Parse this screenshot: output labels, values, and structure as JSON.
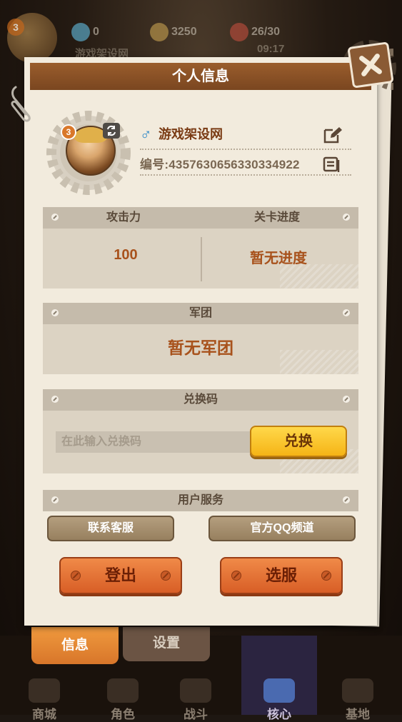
{
  "top_bar": {
    "level": "3",
    "player_name": "游戏架设网",
    "gems": "0",
    "gold": "3250",
    "stamina": "26/30",
    "timer": "09:17"
  },
  "modal": {
    "title": "个人信息",
    "level": "3",
    "player_name": "游戏架设网",
    "player_id": "编号:4357630656330334922",
    "stats": {
      "attack_label": "攻击力",
      "progress_label": "关卡进度",
      "attack_value": "100",
      "progress_value": "暂无进度"
    },
    "legion": {
      "label": "军团",
      "value": "暂无军团"
    },
    "redeem": {
      "label": "兑换码",
      "placeholder": "在此输入兑换码",
      "button": "兑换"
    },
    "service": {
      "label": "用户服务",
      "contact_button": "联系客服",
      "qq_button": "官方QQ频道"
    },
    "logout_button": "登出",
    "server_button": "选服"
  },
  "panel_tabs": [
    "信息",
    "设置"
  ],
  "bottom_nav": [
    "商城",
    "角色",
    "战斗",
    "核心",
    "基地"
  ],
  "colors": {
    "header": "#8a5228",
    "accent_orange": "#e6702f",
    "accent_yellow": "#f8c62c",
    "value_text": "#a8521c"
  }
}
